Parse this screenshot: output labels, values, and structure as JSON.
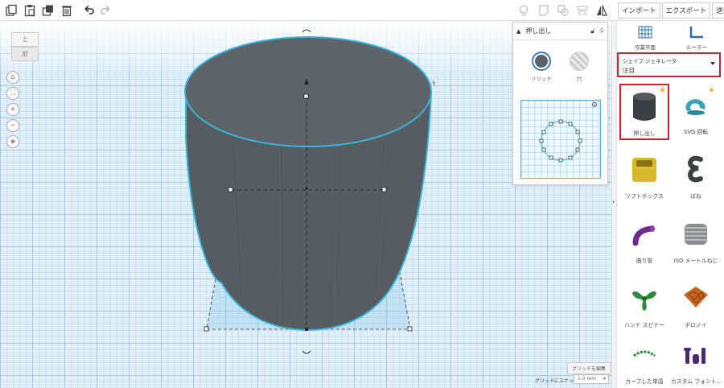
{
  "toolbar": {
    "tools": [
      "copy-icon",
      "paste-icon",
      "duplicate-icon",
      "delete-icon",
      "undo-icon",
      "redo-icon"
    ],
    "right_tools": [
      "light-bulb-icon",
      "note-icon",
      "group-icon",
      "align-icon",
      "mirror-icon"
    ]
  },
  "top_tabs": {
    "import": "インポート",
    "export": "エクスポート",
    "send": "送信先"
  },
  "viewcube": {
    "top": "上",
    "front": "前"
  },
  "inspector": {
    "title": "押し出し",
    "solid_label": "ソリッド",
    "hole_label": "穴",
    "solid_color": "#5c6166"
  },
  "workplane": {
    "edit_grid": "グリッドを編集",
    "snap_label": "グリッドにスナップ",
    "snap_value": "1.0 mm"
  },
  "sidebar": {
    "workplane_label": "作業平面",
    "ruler_label": "ルーラー",
    "category_label": "シェイプ ジェネレータ",
    "category_value": "注目",
    "shapes": [
      {
        "label": "押し出し",
        "icon": "extrude-cylinder-icon"
      },
      {
        "label": "SVG 回転",
        "icon": "svg-revolve-icon"
      },
      {
        "label": "ソフトボックス",
        "icon": "soft-box-icon"
      },
      {
        "label": "ばね",
        "icon": "spring-icon"
      },
      {
        "label": "曲り管",
        "icon": "bent-pipe-icon"
      },
      {
        "label": "ISO メートルねじ",
        "icon": "iso-metric-screw-icon"
      },
      {
        "label": "ハンド スピナー",
        "icon": "hand-spinner-icon"
      },
      {
        "label": "ボロノイ",
        "icon": "voronoi-icon"
      },
      {
        "label": "カーブした単語",
        "icon": "curved-text-icon"
      },
      {
        "label": "カスタム フォント...",
        "icon": "custom-font-icon"
      }
    ]
  },
  "colors": {
    "highlight": "#d0202e",
    "selection": "#36b4e0",
    "cylinder": "#575c61"
  }
}
